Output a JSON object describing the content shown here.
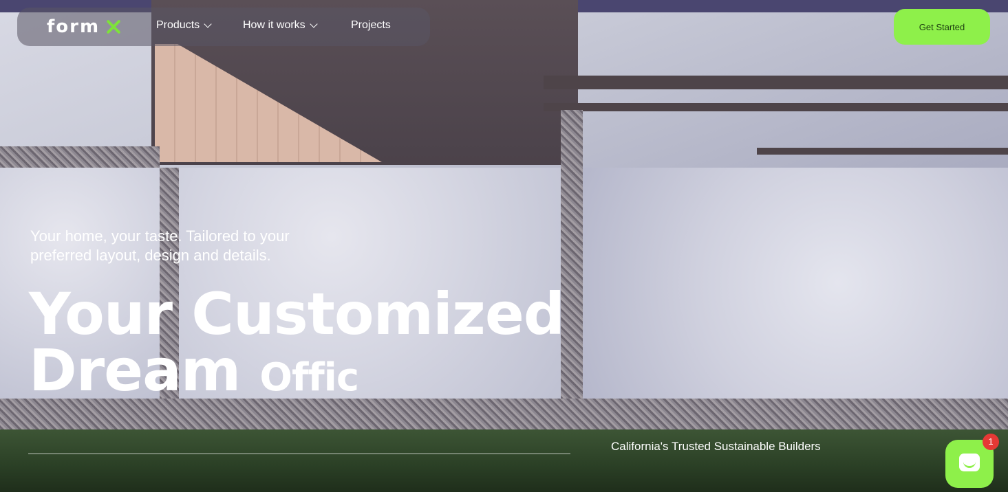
{
  "header": {
    "logo_text": "form",
    "nav": [
      {
        "label": "Products",
        "has_dropdown": true
      },
      {
        "label": "How it works",
        "has_dropdown": true
      },
      {
        "label": "Projects",
        "has_dropdown": false
      }
    ],
    "cta_label": "Get Started"
  },
  "hero": {
    "subtitle": "Your home, your taste. Tailored to your preferred layout, design and details.",
    "headline_line1": "Your Customized",
    "headline_line2": "Dream",
    "headline_typed": "Offic",
    "tagline": "California's Trusted Sustainable Builders"
  },
  "chat": {
    "badge_count": "1",
    "icon": "chat-icon"
  },
  "colors": {
    "accent": "#8ef04a",
    "badge": "#e53935",
    "text": "#ffffff"
  }
}
